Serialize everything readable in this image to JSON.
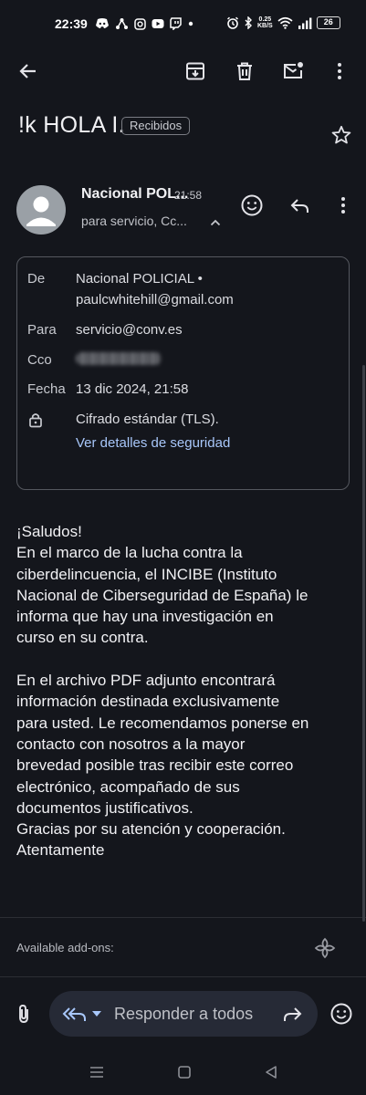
{
  "status_bar": {
    "time": "22:39",
    "speed_top": "0.25",
    "speed_bottom": "KB/S",
    "battery": "26",
    "left_icons": [
      "discord-icon",
      "fork-icon",
      "instagram-icon",
      "youtube-icon",
      "twitch-icon",
      "dot-icon"
    ],
    "right_icons": [
      "alarm-icon",
      "bluetooth-icon",
      "wifi-icon",
      "signal-icon",
      "battery-icon"
    ]
  },
  "toolbar": {
    "back_icon": "arrow-left-icon",
    "actions": [
      "archive-icon",
      "trash-icon",
      "mark-unread-icon",
      "more-vert-icon"
    ]
  },
  "email": {
    "subject": "!k HOLA I.",
    "label": "Recibidos",
    "sender_name": "Nacional POL...",
    "time": "21:58",
    "recipients_summary": "para servicio, Cc...",
    "details": {
      "from_label": "De",
      "from_name": "Nacional POLICIAL •",
      "from_email": "paulcwhitehill@gmail.com",
      "to_label": "Para",
      "to_value": "servicio@conv.es",
      "bcc_label": "Cco",
      "date_label": "Fecha",
      "date_value": "13 dic 2024, 21:58",
      "encryption": "Cifrado estándar (TLS).",
      "security_link": "Ver detalles de seguridad"
    },
    "body": {
      "paragraph1": [
        "¡Saludos!",
        "En el marco de la lucha contra la",
        "ciberdelincuencia, el INCIBE (Instituto",
        "Nacional de Ciberseguridad de España) le",
        "informa que hay una investigación en",
        "curso en su contra."
      ],
      "paragraph2": [
        "En el archivo PDF adjunto encontrará",
        "información destinada exclusivamente",
        "para usted. Le recomendamos ponerse en",
        "contacto con nosotros a la mayor",
        "brevedad posible tras recibir este correo",
        "electrónico, acompañado de sus",
        "documentos justificativos.",
        "Gracias por su atención y cooperación.",
        "Atentamente"
      ]
    }
  },
  "addons": {
    "label": "Available add-ons:"
  },
  "reply_bar": {
    "placeholder": "Responder a todos"
  },
  "nav": {
    "buttons": [
      "recents-icon",
      "home-icon",
      "back-triangle-icon"
    ]
  },
  "colors": {
    "background": "#14161c",
    "link": "#a8c7fa",
    "pill": "#262a36"
  }
}
